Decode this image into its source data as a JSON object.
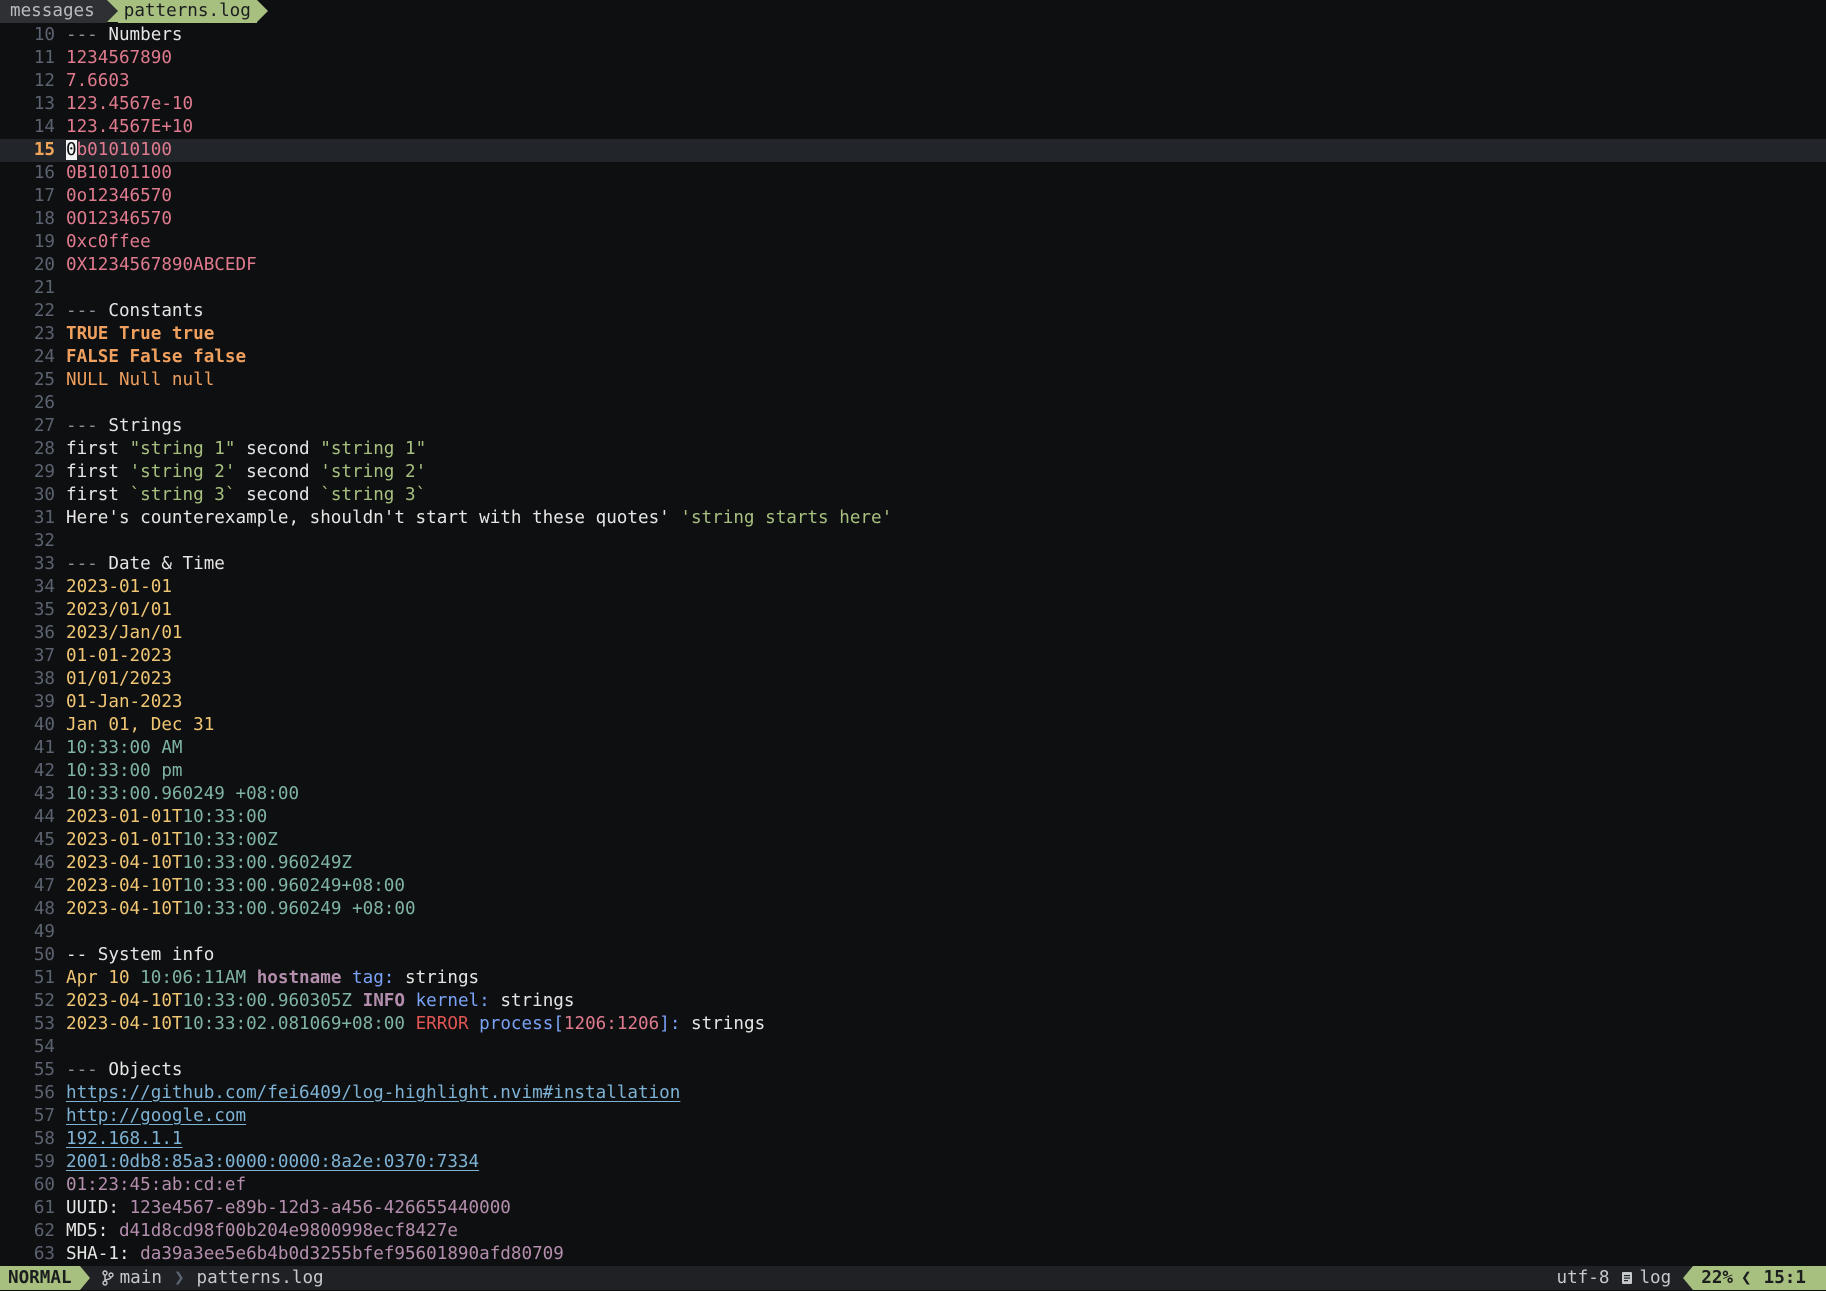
{
  "tabline": {
    "inactive_tab": "messages",
    "active_tab": "patterns.log"
  },
  "editor": {
    "cursor_line": 15,
    "lines": [
      {
        "n": "10",
        "segs": [
          [
            "dash",
            "--- "
          ],
          [
            "heading",
            "Numbers"
          ]
        ]
      },
      {
        "n": "11",
        "segs": [
          [
            "num",
            "1234567890"
          ]
        ]
      },
      {
        "n": "12",
        "segs": [
          [
            "num",
            "7.6603"
          ]
        ]
      },
      {
        "n": "13",
        "segs": [
          [
            "num",
            "123.4567e-10"
          ]
        ]
      },
      {
        "n": "14",
        "segs": [
          [
            "num",
            "123.4567E+10"
          ]
        ]
      },
      {
        "n": "15",
        "segs": [
          [
            "cursor",
            "0"
          ],
          [
            "num",
            "b01010100"
          ]
        ]
      },
      {
        "n": "16",
        "segs": [
          [
            "num",
            "0B10101100"
          ]
        ]
      },
      {
        "n": "17",
        "segs": [
          [
            "num",
            "0o12346570"
          ]
        ]
      },
      {
        "n": "18",
        "segs": [
          [
            "num",
            "0O12346570"
          ]
        ]
      },
      {
        "n": "19",
        "segs": [
          [
            "num",
            "0xc0ffee"
          ]
        ]
      },
      {
        "n": "20",
        "segs": [
          [
            "num",
            "0X1234567890ABCEDF"
          ]
        ]
      },
      {
        "n": "21",
        "segs": []
      },
      {
        "n": "22",
        "segs": [
          [
            "dash",
            "--- "
          ],
          [
            "heading",
            "Constants"
          ]
        ]
      },
      {
        "n": "23",
        "segs": [
          [
            "const",
            "TRUE True true"
          ]
        ]
      },
      {
        "n": "24",
        "segs": [
          [
            "const",
            "FALSE False false"
          ]
        ]
      },
      {
        "n": "25",
        "segs": [
          [
            "const-n",
            "NULL Null null"
          ]
        ]
      },
      {
        "n": "26",
        "segs": []
      },
      {
        "n": "27",
        "segs": [
          [
            "dash",
            "--- "
          ],
          [
            "heading",
            "Strings"
          ]
        ]
      },
      {
        "n": "28",
        "segs": [
          [
            "plain",
            "first "
          ],
          [
            "str",
            "\"string 1\""
          ],
          [
            "plain",
            " second "
          ],
          [
            "str",
            "\"string 1\""
          ]
        ]
      },
      {
        "n": "29",
        "segs": [
          [
            "plain",
            "first "
          ],
          [
            "str",
            "'string 2'"
          ],
          [
            "plain",
            " second "
          ],
          [
            "str",
            "'string 2'"
          ]
        ]
      },
      {
        "n": "30",
        "segs": [
          [
            "plain",
            "first "
          ],
          [
            "str",
            "`string 3`"
          ],
          [
            "plain",
            " second "
          ],
          [
            "str",
            "`string 3`"
          ]
        ]
      },
      {
        "n": "31",
        "segs": [
          [
            "plain",
            "Here's counterexample, shouldn't start with these quotes' "
          ],
          [
            "str",
            "'string starts here'"
          ]
        ]
      },
      {
        "n": "32",
        "segs": []
      },
      {
        "n": "33",
        "segs": [
          [
            "dash",
            "--- "
          ],
          [
            "heading",
            "Date & Time"
          ]
        ]
      },
      {
        "n": "34",
        "segs": [
          [
            "date",
            "2023-01-01"
          ]
        ]
      },
      {
        "n": "35",
        "segs": [
          [
            "date",
            "2023/01/01"
          ]
        ]
      },
      {
        "n": "36",
        "segs": [
          [
            "date",
            "2023/Jan/01"
          ]
        ]
      },
      {
        "n": "37",
        "segs": [
          [
            "date",
            "01-01-2023"
          ]
        ]
      },
      {
        "n": "38",
        "segs": [
          [
            "date",
            "01/01/2023"
          ]
        ]
      },
      {
        "n": "39",
        "segs": [
          [
            "date",
            "01-Jan-2023"
          ]
        ]
      },
      {
        "n": "40",
        "segs": [
          [
            "date",
            "Jan 01, Dec 31"
          ]
        ]
      },
      {
        "n": "41",
        "segs": [
          [
            "time",
            "10:33:00 AM"
          ]
        ]
      },
      {
        "n": "42",
        "segs": [
          [
            "time",
            "10:33:00 pm"
          ]
        ]
      },
      {
        "n": "43",
        "segs": [
          [
            "time",
            "10:33:00.960249 +08:00"
          ]
        ]
      },
      {
        "n": "44",
        "segs": [
          [
            "date",
            "2023-01-01T"
          ],
          [
            "time",
            "10:33:00"
          ]
        ]
      },
      {
        "n": "45",
        "segs": [
          [
            "date",
            "2023-01-01T"
          ],
          [
            "time",
            "10:33:00Z"
          ]
        ]
      },
      {
        "n": "46",
        "segs": [
          [
            "date",
            "2023-04-10T"
          ],
          [
            "time",
            "10:33:00.960249Z"
          ]
        ]
      },
      {
        "n": "47",
        "segs": [
          [
            "date",
            "2023-04-10T"
          ],
          [
            "time",
            "10:33:00.960249+08:00"
          ]
        ]
      },
      {
        "n": "48",
        "segs": [
          [
            "date",
            "2023-04-10T"
          ],
          [
            "time",
            "10:33:00.960249 +08:00"
          ]
        ]
      },
      {
        "n": "49",
        "segs": []
      },
      {
        "n": "50",
        "segs": [
          [
            "plain",
            "-- System info"
          ]
        ]
      },
      {
        "n": "51",
        "segs": [
          [
            "date",
            "Apr 10 "
          ],
          [
            "time",
            "10:06:11AM "
          ],
          [
            "host",
            "hostname "
          ],
          [
            "kw",
            "tag:"
          ],
          [
            "plain",
            " strings"
          ]
        ]
      },
      {
        "n": "52",
        "segs": [
          [
            "date",
            "2023-04-10T"
          ],
          [
            "time",
            "10:33:00.960305Z "
          ],
          [
            "info",
            "INFO "
          ],
          [
            "kw",
            "kernel:"
          ],
          [
            "plain",
            " strings"
          ]
        ]
      },
      {
        "n": "53",
        "segs": [
          [
            "date",
            "2023-04-10T"
          ],
          [
            "time",
            "10:33:02.081069+08:00 "
          ],
          [
            "err",
            "ERROR "
          ],
          [
            "kw",
            "process["
          ],
          [
            "pid",
            "1206:1206"
          ],
          [
            "kw",
            "]:"
          ],
          [
            "plain",
            " strings"
          ]
        ]
      },
      {
        "n": "54",
        "segs": []
      },
      {
        "n": "55",
        "segs": [
          [
            "dash",
            "--- "
          ],
          [
            "heading",
            "Objects"
          ]
        ]
      },
      {
        "n": "56",
        "segs": [
          [
            "url",
            "https://github.com/fei6409/log-highlight.nvim#installation"
          ]
        ]
      },
      {
        "n": "57",
        "segs": [
          [
            "url",
            "http://google.com"
          ]
        ]
      },
      {
        "n": "58",
        "segs": [
          [
            "url",
            "192.168.1.1"
          ]
        ]
      },
      {
        "n": "59",
        "segs": [
          [
            "url",
            "2001:0db8:85a3:0000:0000:8a2e:0370:7334"
          ]
        ]
      },
      {
        "n": "60",
        "segs": [
          [
            "mac",
            "01:23:45:ab:cd:ef"
          ]
        ]
      },
      {
        "n": "61",
        "segs": [
          [
            "plain",
            "UUID: "
          ],
          [
            "hash",
            "123e4567-e89b-12d3-a456-426655440000"
          ]
        ]
      },
      {
        "n": "62",
        "segs": [
          [
            "plain",
            "MD5: "
          ],
          [
            "hash",
            "d41d8cd98f00b204e9800998ecf8427e"
          ]
        ]
      },
      {
        "n": "63",
        "segs": [
          [
            "plain",
            "SHA-1: "
          ],
          [
            "hash",
            "da39a3ee5e6b4b0d3255bfef95601890afd80709"
          ]
        ]
      }
    ]
  },
  "statusline": {
    "mode": "NORMAL",
    "branch_icon": "git-branch-icon",
    "branch": "main",
    "filename": "patterns.log",
    "encoding": "utf-8",
    "filetype_icon": "document-icon",
    "filetype": "log",
    "percent": "22%",
    "position": "15:1"
  },
  "colors": {
    "background": "#0e0f10",
    "accent": "#a7c080",
    "number": "#e07a8f",
    "constant": "#f0a05e",
    "string": "#a7c080",
    "date": "#f0c674",
    "time": "#7fb3a3",
    "error": "#e05555",
    "keyword": "#7aa2f7",
    "url": "#7fb3d5",
    "hash": "#b48ead"
  }
}
